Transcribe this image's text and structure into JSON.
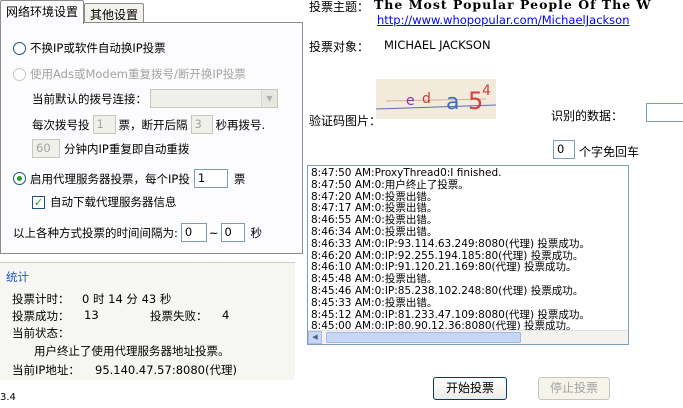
{
  "tabs": [
    {
      "label": "网络环境设置",
      "active": true
    },
    {
      "label": "其他设置",
      "active": false
    }
  ],
  "network": {
    "option_no_ip_change": "不换IP或软件自动换IP投票",
    "option_adsl": "使用Ads或Modem重复拨号/断开换IP投票",
    "default_dial_label": "当前默认的拨号连接：",
    "default_dial_value": "",
    "dial_every_label": "每次拨号投",
    "dial_every_value": "1",
    "dial_votes_suffix": "票，断开后隔",
    "dial_wait_value": "3",
    "dial_wait_suffix": "秒再拨号.",
    "repeat_minutes_value": "60",
    "repeat_suffix": "分钟内IP重复即自动重拨",
    "option_proxy": "启用代理服务器投票，每个IP投",
    "proxy_votes_value": "1",
    "proxy_votes_suffix": "票",
    "auto_download_label": "自动下载代理服务器信息",
    "interval_label": "以上各种方式投票的时间间隔为:",
    "interval_from": "0",
    "interval_sep": "~",
    "interval_to": "0",
    "interval_unit": "秒"
  },
  "stats": {
    "title": "统计",
    "timer_label": "投票计时：",
    "timer_value": "0 时 14 分 43 秒",
    "success_label": "投票成功：",
    "success_value": "13",
    "fail_label": "投票失败：",
    "fail_value": "4",
    "status_label": "当前状态：",
    "status_value": "用户终止了使用代理服务器地址投票。",
    "ip_label": "当前IP地址：",
    "ip_value": "95.140.47.57:8080(代理)"
  },
  "version_fragment": "3.4",
  "vote": {
    "topic_label": "投票主题：",
    "topic_value": "The Most Popular People Of The W",
    "topic_url": "http://www.whopopular.com/MichaelJackson",
    "target_label": "投票对象：",
    "target_value": "MICHAEL JACKSON",
    "captcha_label": "验证码图片：",
    "captcha_text": "eda54",
    "recognized_label": "识别的数据：",
    "free_count_value": "0",
    "free_count_suffix": "个字免回车"
  },
  "log_lines": [
    "8:47:50 AM:ProxyThread0:I finished.",
    "8:47:50 AM:0:用户终止了投票。",
    "8:47:20 AM:0:投票出错。",
    "8:47:17 AM:0:投票出错。",
    "8:46:55 AM:0:投票出错。",
    "8:46:34 AM:0:投票出错。",
    "8:46:33 AM:0:IP:93.114.63.249:8080(代理) 投票成功。",
    "8:46:20 AM:0:IP:92.255.194.185:80(代理) 投票成功。",
    "8:46:10 AM:0:IP:91.120.21.169:80(代理) 投票成功。",
    "8:45:48 AM:0:投票出错。",
    "8:45:46 AM:0:IP:85.238.102.248:80(代理) 投票成功。",
    "8:45:33 AM:0:投票出错。",
    "8:45:12 AM:0:IP:81.233.47.109:8080(代理) 投票成功。",
    "8:45:00 AM:0:IP:80.90.12.36:8080(代理) 投票成功。"
  ],
  "buttons": {
    "start": "开始投票",
    "stop": "停止投票"
  },
  "colors": {
    "link": "#0000ff",
    "group_title": "#2457c7",
    "radio_dot": "#21a121"
  }
}
